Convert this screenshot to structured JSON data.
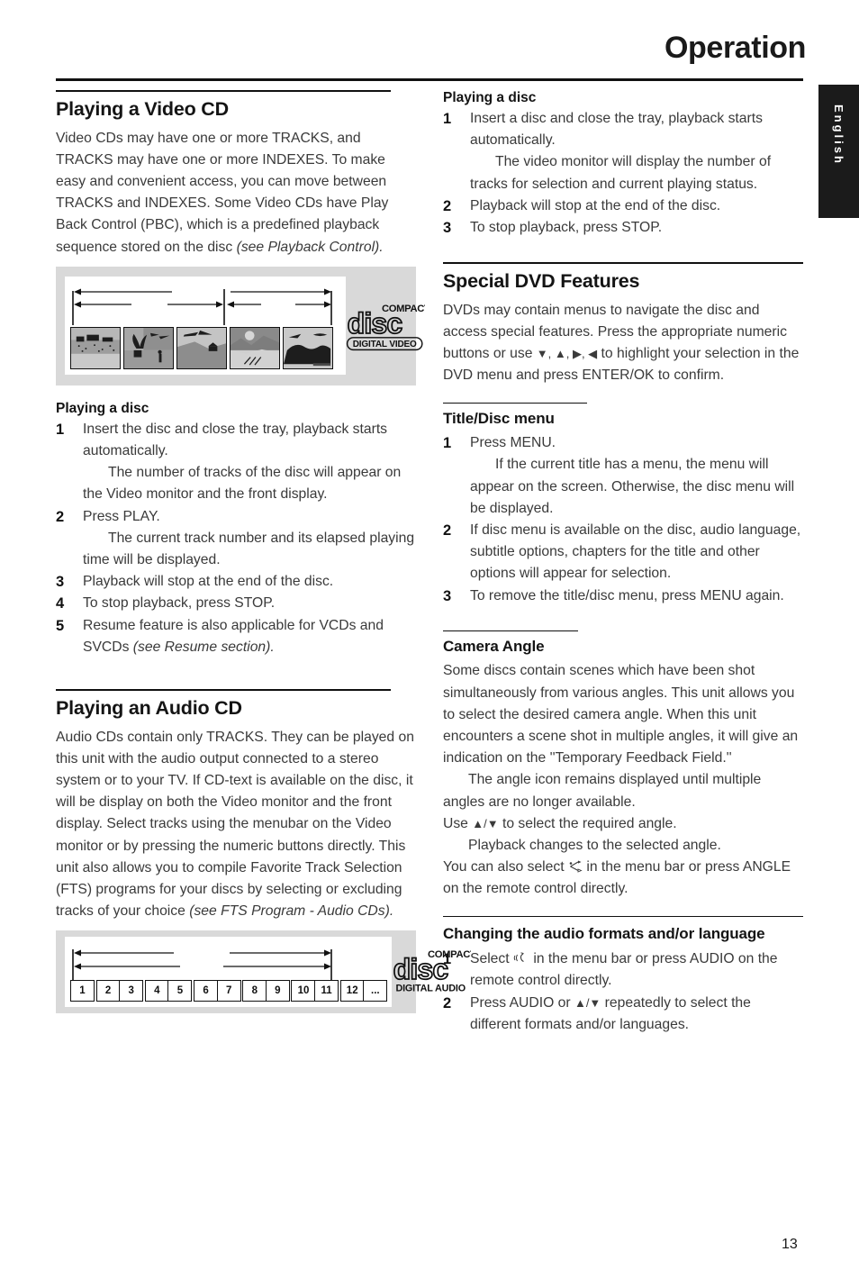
{
  "page": {
    "title": "Operation",
    "number": "13",
    "language_tab": "English"
  },
  "left_column": {
    "section1": {
      "heading": "Playing a Video CD",
      "intro": "Video CDs may have one or more TRACKS, and TRACKS may have one or more INDEXES.\nTo make easy and convenient access, you can move between TRACKS and INDEXES.\nSome Video CDs have Play Back Control (PBC), which is a predefined playback sequence stored on the disc ",
      "intro_italic": "(see Playback Control).",
      "figure": {
        "name": "video-cd-track-index-diagram",
        "logo_top": "COMPACT",
        "logo_mid": "disc",
        "logo_bottom": "DIGITAL VIDEO",
        "thumb_count": 5
      },
      "subheading": "Playing a disc",
      "steps": [
        {
          "num": "1",
          "text": "Insert the disc and close the tray, playback starts automatically.",
          "note": "The number of tracks of the disc will appear on the Video monitor and the front display."
        },
        {
          "num": "2",
          "text": "Press PLAY.",
          "note": "The current track number and its elapsed playing time will be displayed."
        },
        {
          "num": "3",
          "text": "Playback will stop at the end of the disc.",
          "note": ""
        },
        {
          "num": "4",
          "text": "To stop playback, press STOP.",
          "note": ""
        },
        {
          "num": "5",
          "text": "Resume feature is also applicable for VCDs and SVCDs ",
          "note": "",
          "italic": "(see Resume section)."
        }
      ]
    },
    "section2": {
      "heading": "Playing an Audio CD",
      "body": "Audio CDs contain only TRACKS.\nThey can be played on this unit with the audio output connected to a stereo system or to your TV.\nIf CD-text is available on the disc, it will be display on both the Video monitor and the front display.\nSelect tracks using the menubar on the Video monitor or by pressing the numeric buttons directly.\nThis unit also allows you to compile Favorite Track Selection (FTS) programs for your discs by selecting or excluding tracks of your choice ",
      "body_italic": "(see FTS Program - Audio CDs).",
      "figure": {
        "name": "audio-cd-track-diagram",
        "logo_top": "COMPACT",
        "logo_mid": "disc",
        "logo_bottom": "DIGITAL AUDIO",
        "tracks": [
          "1",
          "2",
          "3",
          "4",
          "5",
          "6",
          "7",
          "8",
          "9",
          "10",
          "11",
          "12",
          "..."
        ]
      }
    }
  },
  "right_column": {
    "playing_disc": {
      "subheading": "Playing a disc",
      "steps": [
        {
          "num": "1",
          "text": "Insert a disc and close the tray, playback starts automatically.",
          "note": "The video monitor will display the number of tracks for selection and current playing status."
        },
        {
          "num": "2",
          "text": "Playback will stop at the end of the disc.",
          "note": ""
        },
        {
          "num": "3",
          "text": "To stop playback, press STOP.",
          "note": ""
        }
      ]
    },
    "special_dvd": {
      "heading": "Special DVD Features",
      "body_1": "DVDs may contain menus to navigate the disc and access special features. Press the appropriate numeric buttons or use ",
      "arrows": "▼, ▲, ▶, ◀",
      "body_2": " to highlight your selection in the DVD menu and press ENTER/OK to confirm."
    },
    "title_disc_menu": {
      "heading": "Title/Disc menu",
      "steps": [
        {
          "num": "1",
          "text": "Press MENU.",
          "note": "If the current title has a menu, the menu will appear on the screen. Otherwise, the disc menu will be displayed."
        },
        {
          "num": "2",
          "text": "If disc menu is available on the disc, audio language, subtitle options, chapters for the title and other options will appear for selection.",
          "note": ""
        },
        {
          "num": "3",
          "text": "To remove the title/disc menu, press MENU again.",
          "note": ""
        }
      ]
    },
    "camera_angle": {
      "heading": "Camera Angle",
      "para_1": "Some discs contain scenes which have been shot simultaneously from various angles.\nThis unit allows you to select the desired camera angle.\nWhen this unit encounters a scene shot in multiple angles, it will give an indication on the ''Temporary Feedback Field.''",
      "para_2_note": "The angle icon remains displayed until multiple angles are no longer available.",
      "para_3_pre": "Use ",
      "para_3_arrows": "▲/▼",
      "para_3_post": " to select the required angle.",
      "para_4_note": "Playback changes to the selected angle.",
      "para_5_pre": "You can also select ",
      "para_5_icon": "angle-icon",
      "para_5_post": " in the menu bar or press ANGLE on the remote control directly."
    },
    "audio_formats": {
      "heading": "Changing the audio formats and/or language",
      "steps": [
        {
          "num": "1",
          "pre": "Select ",
          "icon": "audio-icon",
          "post": " in the menu bar or press AUDIO on the remote control directly."
        },
        {
          "num": "2",
          "pre": "Press AUDIO or ",
          "arrows": "▲/▼",
          "post": " repeatedly to select the different formats and/or languages."
        }
      ]
    }
  },
  "colors": {
    "text": "#3a3a3a",
    "heading": "#141414",
    "figure_bg": "#d9d9d9",
    "tab_bg": "#1b1b1b"
  }
}
